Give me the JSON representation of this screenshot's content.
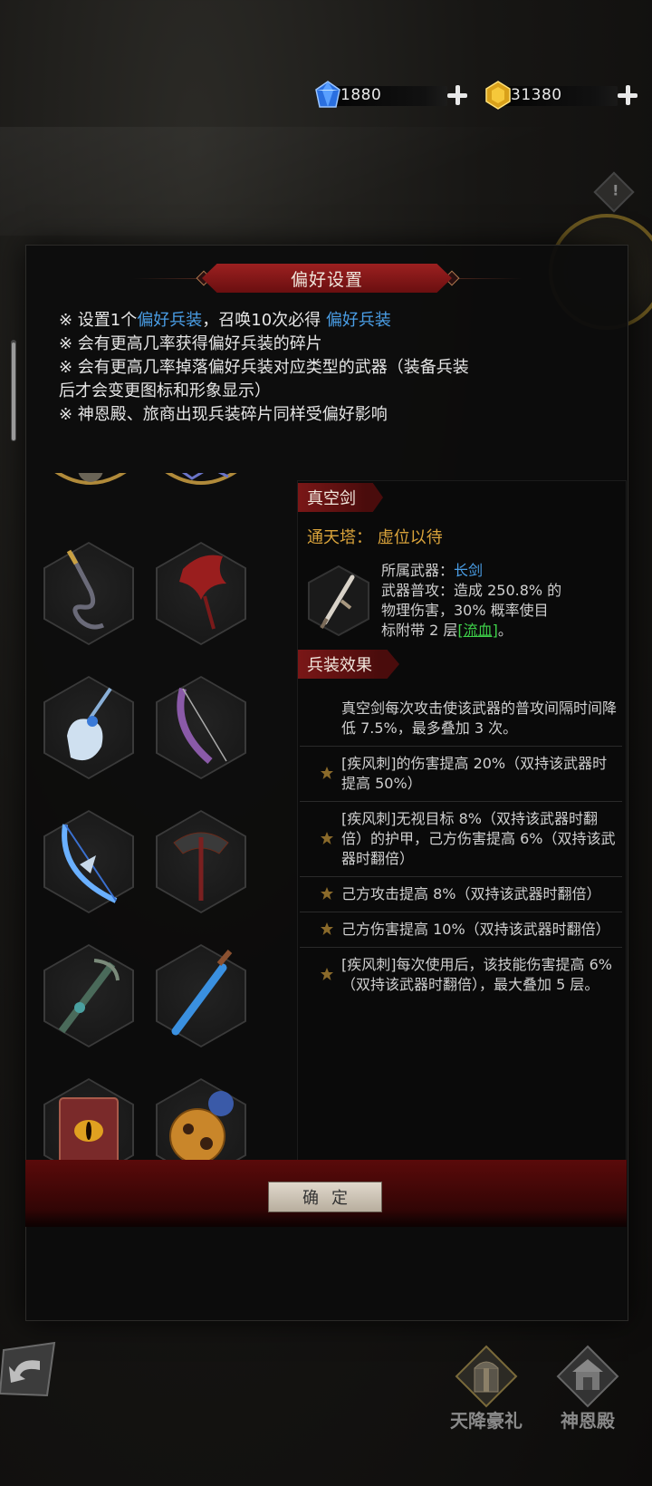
{
  "currency": {
    "diamond": {
      "icon": "blue-diamond-icon",
      "value": "1880"
    },
    "gold": {
      "icon": "gold-gem-icon",
      "value": "31380"
    }
  },
  "dialog": {
    "title": "偏好设置",
    "notes": {
      "line1_a": "※ 设置1个",
      "line1_hl1": "偏好兵装",
      "line1_b": "，召唤10次必得 ",
      "line1_hl2": "偏好兵装",
      "line2": "※ 会有更高几率获得偏好兵装的碎片",
      "line3a": "※ 会有更高几率掉落偏好兵装对应类型的武器（装备兵装",
      "line3b": "后才会变更图标和形象显示）",
      "line4": "※ 神恩殿、旅商出现兵装碎片同样受偏好影响"
    },
    "weapons": [
      {
        "name": "whip-weapon-icon"
      },
      {
        "name": "dragon-wing-weapon-icon"
      },
      {
        "name": "frost-fan-weapon-icon"
      },
      {
        "name": "purple-bow-weapon-icon"
      },
      {
        "name": "ice-bow-weapon-icon"
      },
      {
        "name": "dark-axe-weapon-icon"
      },
      {
        "name": "vine-crossbow-weapon-icon"
      },
      {
        "name": "blue-sword-weapon-icon"
      },
      {
        "name": "eye-tome-weapon-icon"
      },
      {
        "name": "gold-orb-weapon-icon"
      }
    ],
    "detail": {
      "name": "真空剑",
      "tower_label": "通天塔：",
      "tower_value": "虚位以待",
      "weapon_type_label": "所属武器：",
      "weapon_type": "长剑",
      "attack_line1": "武器普攻：造成 250.8% 的",
      "attack_line2": "物理伤害，30% 概率使目",
      "attack_line3a": "标附带 2 层",
      "attack_bleed": "[流血]",
      "attack_line3b": "。",
      "effects_title": "兵装效果",
      "effects": [
        {
          "text": "真空剑每次攻击使该武器的普攻间隔时间降低 7.5%，最多叠加 3 次。",
          "locked": false
        },
        {
          "text": "[疾风刺]的伤害提高 20%（双持该武器时提高 50%）",
          "locked": true
        },
        {
          "text": "[疾风刺]无视目标 8%（双持该武器时翻倍）的护甲，己方伤害提高 6%（双持该武器时翻倍）",
          "locked": true
        },
        {
          "text": "己方攻击提高 8%（双持该武器时翻倍）",
          "locked": true
        },
        {
          "text": "己方伤害提高 10%（双持该武器时翻倍）",
          "locked": true
        },
        {
          "text": "[疾风刺]每次使用后，该技能伤害提高 6%（双持该武器时翻倍），最大叠加 5 层。",
          "locked": true
        }
      ]
    },
    "confirm_label": "确定"
  },
  "bottom_nav": {
    "items": [
      {
        "label": "天降豪礼",
        "icon": "gift-chest-icon"
      },
      {
        "label": "神恩殿",
        "icon": "temple-icon"
      }
    ]
  }
}
